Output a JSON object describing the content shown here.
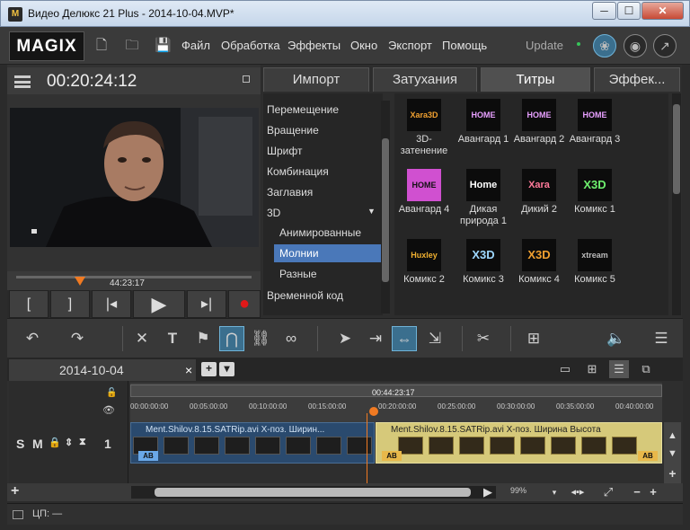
{
  "window": {
    "title": "Видео Делюкс 21 Plus - 2014-10-04.MVP*",
    "min_label": "─",
    "max_label": "☐",
    "close_label": "✕"
  },
  "menubar": {
    "logo": "MAGIX",
    "items": [
      "Файл",
      "Обработка",
      "Эффекты",
      "Окно",
      "Экспорт",
      "Помощь"
    ],
    "update_label": "Update"
  },
  "preview": {
    "timecode": "00:20:24:12",
    "scrub_time": "44:23:17"
  },
  "transport": {
    "labels": [
      "[",
      "]",
      "|◂",
      "▶",
      "▸|",
      "●"
    ]
  },
  "media_tabs": [
    "Импорт",
    "Затухания",
    "Титры",
    "Эффек..."
  ],
  "categories": [
    {
      "label": "Перемещение"
    },
    {
      "label": "Вращение"
    },
    {
      "label": "Шрифт"
    },
    {
      "label": "Комбинация"
    },
    {
      "label": "Заглавия"
    },
    {
      "label": "3D"
    },
    {
      "label": "Анимированные"
    },
    {
      "label": "Молнии"
    },
    {
      "label": "Разные"
    },
    {
      "label": "Временной код"
    }
  ],
  "title_templates": [
    {
      "caption": "3D-затенение",
      "art": "Xara3D"
    },
    {
      "caption": "Авангард 1",
      "art": "HOME"
    },
    {
      "caption": "Авангард 2",
      "art": "HOME"
    },
    {
      "caption": "Авангард 3",
      "art": "HOME"
    },
    {
      "caption": "Авангард 4",
      "art": "HOME"
    },
    {
      "caption": "Дикая природа 1",
      "art": "Home"
    },
    {
      "caption": "Дикий 2",
      "art": "Xara"
    },
    {
      "caption": "Комикс 1",
      "art": "X3D"
    },
    {
      "caption": "Комикс 2",
      "art": "Huxley"
    },
    {
      "caption": "Комикс 3",
      "art": "X3D"
    },
    {
      "caption": "Комикс 4",
      "art": "X3D"
    },
    {
      "caption": "Комикс 5",
      "art": "xtream"
    }
  ],
  "timeline": {
    "project_tab": "2014-10-04",
    "close_label": "×",
    "add_label": "+",
    "dropdown_label": "▾",
    "ruler_position": "00:44:23:17",
    "ruler_ticks": [
      "00:00:00:00",
      "00:05:00:00",
      "00:10:00:00",
      "00:15:00:00",
      "00:20:00:00",
      "00:25:00:00",
      "00:30:00:00",
      "00:35:00:00",
      "00:40:00:00"
    ],
    "track_number": "1",
    "track_solo": "S",
    "track_mute": "M",
    "clip1_label": "Ment.Shilov.8.15.SATRip.avi   X-поз.  Ширин...",
    "clip2_label": "Ment.Shilov.8.15.SATRip.avi   X-поз.  Ширина  Высота",
    "ab_label": "AB",
    "zoom": "99%",
    "footer_add": "+"
  },
  "status": {
    "text": "ЦП: —"
  },
  "colors": {
    "accent": "#f07a22",
    "selection": "#4a78b9",
    "clip_blue": "#2a4a6e",
    "clip_yellow": "#d6c97a"
  }
}
